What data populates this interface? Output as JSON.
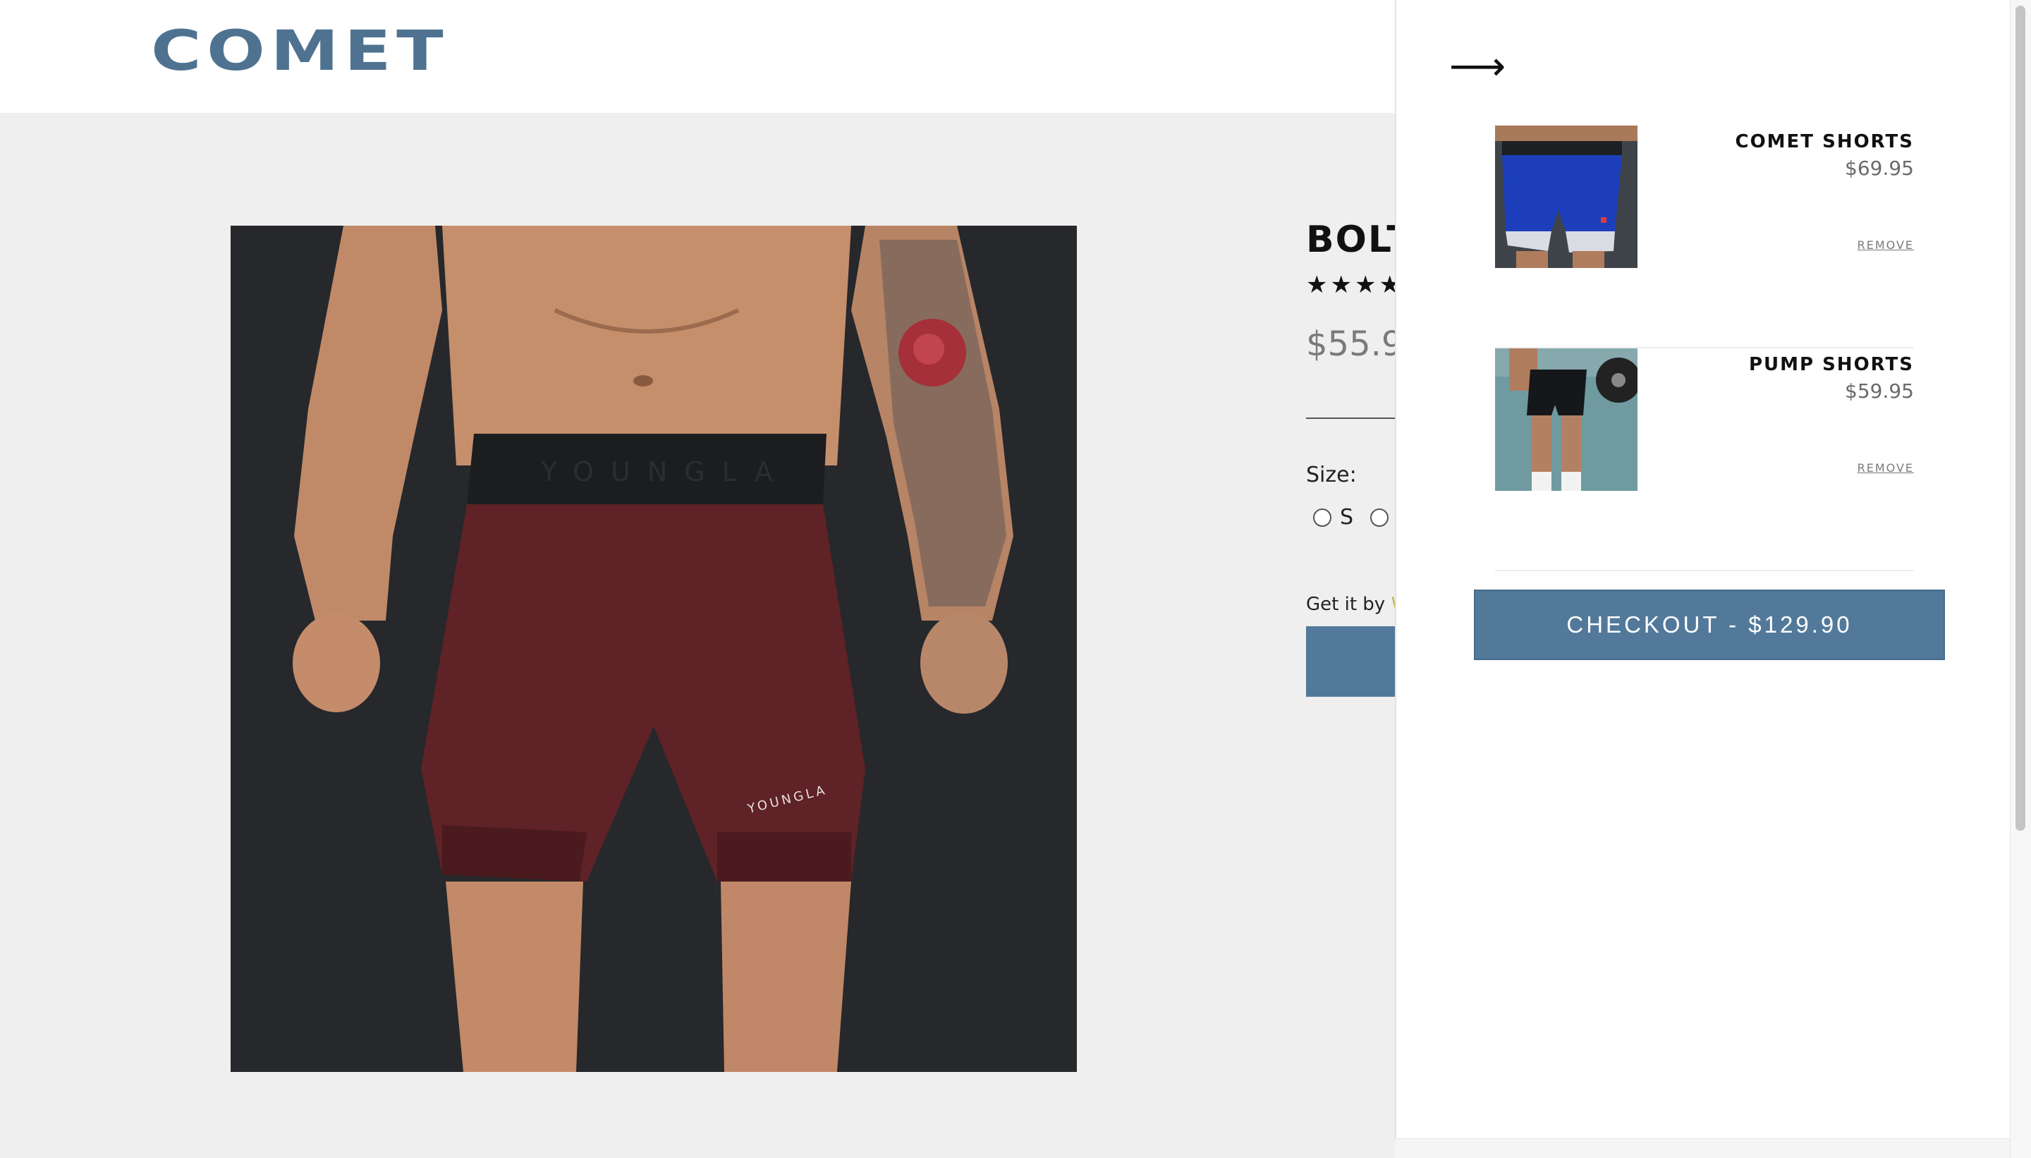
{
  "brand": {
    "logo_text": "COMET",
    "logo_color": "#4f7291"
  },
  "product": {
    "title": "BOLT",
    "rating_stars": "★★★★",
    "price": "$55.9",
    "size_label": "Size:",
    "sizes": [
      {
        "label": "S"
      },
      {
        "label": ""
      }
    ],
    "delivery_prefix": "Get it by ",
    "delivery_highlight": "W",
    "image": {
      "waistband_text": "YOUNGLA",
      "logo_text": "YOUNGLA"
    }
  },
  "cart_drawer": {
    "close_icon": "arrow-right-icon",
    "close_glyph": "⟶",
    "items": [
      {
        "name": "COMET SHORTS",
        "price": "$69.95",
        "remove_label": "REMOVE"
      },
      {
        "name": "PUMP SHORTS",
        "price": "$59.95",
        "remove_label": "REMOVE"
      }
    ],
    "checkout_label": "CHECKOUT - $129.90"
  },
  "colors": {
    "accent": "#52799a",
    "background": "#efefef",
    "drawer": "#ffffff"
  }
}
